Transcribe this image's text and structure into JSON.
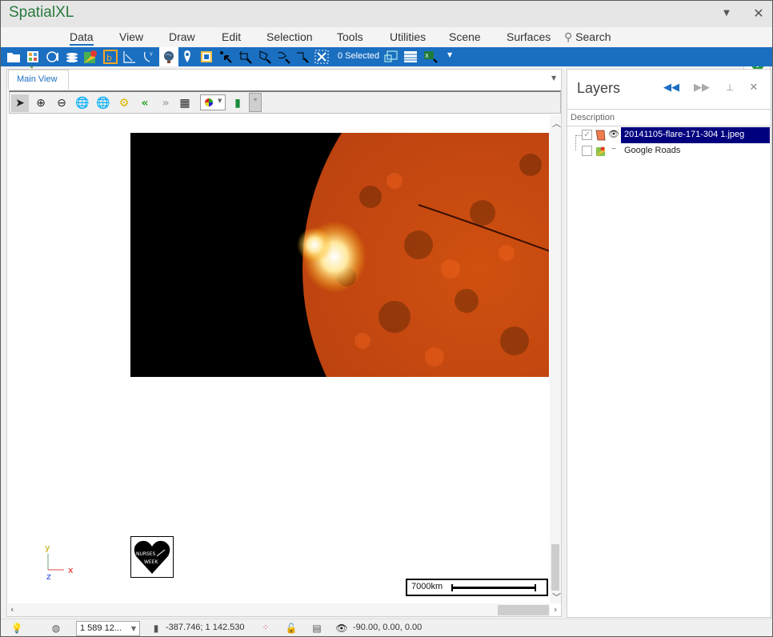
{
  "window": {
    "title": "SpatialXL"
  },
  "menu": {
    "items": [
      {
        "label": "Data",
        "active": true
      },
      {
        "label": "View"
      },
      {
        "label": "Draw"
      },
      {
        "label": "Edit"
      },
      {
        "label": "Selection"
      },
      {
        "label": "Tools"
      },
      {
        "label": "Utilities"
      },
      {
        "label": "Scene"
      },
      {
        "label": "Surfaces"
      }
    ],
    "search_label": "Search",
    "help_label": "?"
  },
  "ribbon": {
    "selected_count_label": "0 Selected",
    "icons": [
      "open-folder",
      "catalog",
      "style-palette",
      "layers-stack",
      "google-maps",
      "bing-maps",
      "measure",
      "coordinate-system",
      "globe",
      "map-pin",
      "frame",
      "select-point",
      "select-rect",
      "select-polygon",
      "select-freehand",
      "select-line",
      "clear-selection",
      "select-by-map",
      "attribute-table",
      "export-excel",
      "more-dropdown"
    ]
  },
  "main_view": {
    "tab_label": "Main View",
    "toolbar_icons": [
      "pointer",
      "zoom-in",
      "zoom-out",
      "globe-full-extent",
      "globe-zoom-extent",
      "settings-gear",
      "previous-view",
      "next-view",
      "grid",
      "color-theme-dropdown",
      "bookmark",
      "star"
    ],
    "image_layer": "20141105-flare-171-304 1.jpeg",
    "axis": {
      "x": "x",
      "y": "y",
      "z": "z"
    },
    "logo_text": [
      "NURSES",
      "WEEK"
    ],
    "scale_label": "7000km"
  },
  "layers": {
    "title": "Layers",
    "column_header": "Description",
    "items": [
      {
        "name": "20141105-flare-171-304 1.jpeg",
        "checked": true,
        "visible": true,
        "selected": true
      },
      {
        "name": "Google Roads",
        "checked": false,
        "visible": false,
        "selected": false
      }
    ]
  },
  "statusbar": {
    "scale_value": "1 589 12...",
    "mouse_coords": "-387.746; 1 142.530",
    "camera_angles": "-90.00, 0.00, 0.00"
  },
  "colors": {
    "accent": "#1a6fc1",
    "title_green": "#2a7a3e",
    "selection": "#00007f"
  }
}
